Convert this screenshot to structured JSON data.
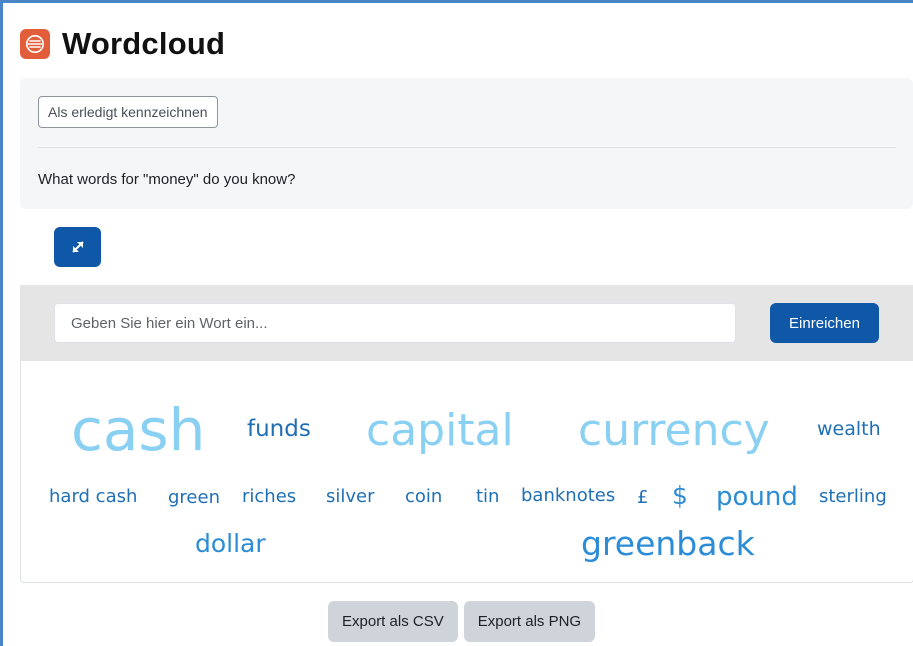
{
  "header": {
    "title": "Wordcloud",
    "icon": "wordcloud-module-icon",
    "icon_color": "#e25e3b"
  },
  "activity": {
    "mark_done_label": "Als erledigt kennzeichnen",
    "question": "What words for \"money\" do you know?"
  },
  "toolbar": {
    "fullscreen_icon": "expand-arrows-icon",
    "accent_color": "#0f58a8"
  },
  "form": {
    "placeholder": "Geben Sie hier ein Wort ein...",
    "submit_label": "Einreichen"
  },
  "cloud": {
    "words": [
      {
        "text": "cash",
        "weight": "largest"
      },
      {
        "text": "funds",
        "weight": "small"
      },
      {
        "text": "capital",
        "weight": "large"
      },
      {
        "text": "currency",
        "weight": "large"
      },
      {
        "text": "wealth",
        "weight": "small"
      },
      {
        "text": "hard cash",
        "weight": "small"
      },
      {
        "text": "green",
        "weight": "small"
      },
      {
        "text": "riches",
        "weight": "small"
      },
      {
        "text": "silver",
        "weight": "small"
      },
      {
        "text": "coin",
        "weight": "small"
      },
      {
        "text": "tin",
        "weight": "small"
      },
      {
        "text": "banknotes",
        "weight": "small"
      },
      {
        "text": "£",
        "weight": "small"
      },
      {
        "text": "$",
        "weight": "medium"
      },
      {
        "text": "pound",
        "weight": "medium"
      },
      {
        "text": "sterling",
        "weight": "small"
      },
      {
        "text": "dollar",
        "weight": "medium"
      },
      {
        "text": "greenback",
        "weight": "medium"
      }
    ],
    "colors": {
      "large": "#8ad0f3",
      "medium": "#2c8dd6",
      "small": "#1f6fb5"
    }
  },
  "export": {
    "csv_label": "Export als CSV",
    "png_label": "Export als PNG"
  }
}
